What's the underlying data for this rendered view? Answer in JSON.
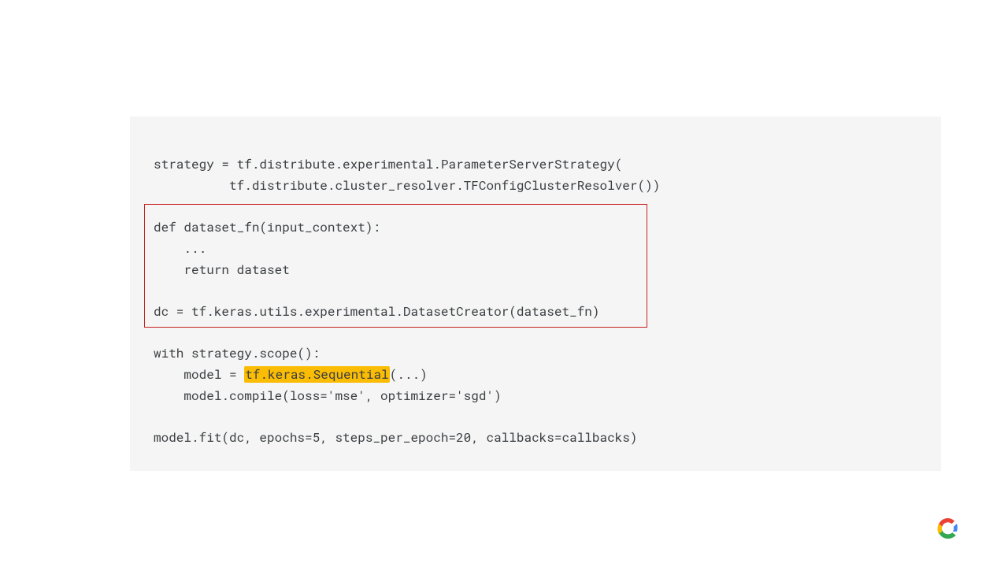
{
  "code": {
    "line1": "strategy = tf.distribute.experimental.ParameterServerStrategy(",
    "line2": "          tf.distribute.cluster_resolver.TFConfigClusterResolver())",
    "line3": "",
    "line4": "def dataset_fn(input_context):",
    "line5": "    ...",
    "line6": "    return dataset",
    "line7": "",
    "line8": "dc = tf.keras.utils.experimental.DatasetCreator(dataset_fn)",
    "line9": "",
    "line10": "with strategy.scope():",
    "line11_pre": "    model = ",
    "line11_hl": "tf.keras.Sequential",
    "line11_post": "(...)",
    "line12": "    model.compile(loss='mse', optimizer='sgd')",
    "line13": "",
    "line14": "model.fit(dc, epochs=5, steps_per_epoch=20, callbacks=callbacks)"
  }
}
